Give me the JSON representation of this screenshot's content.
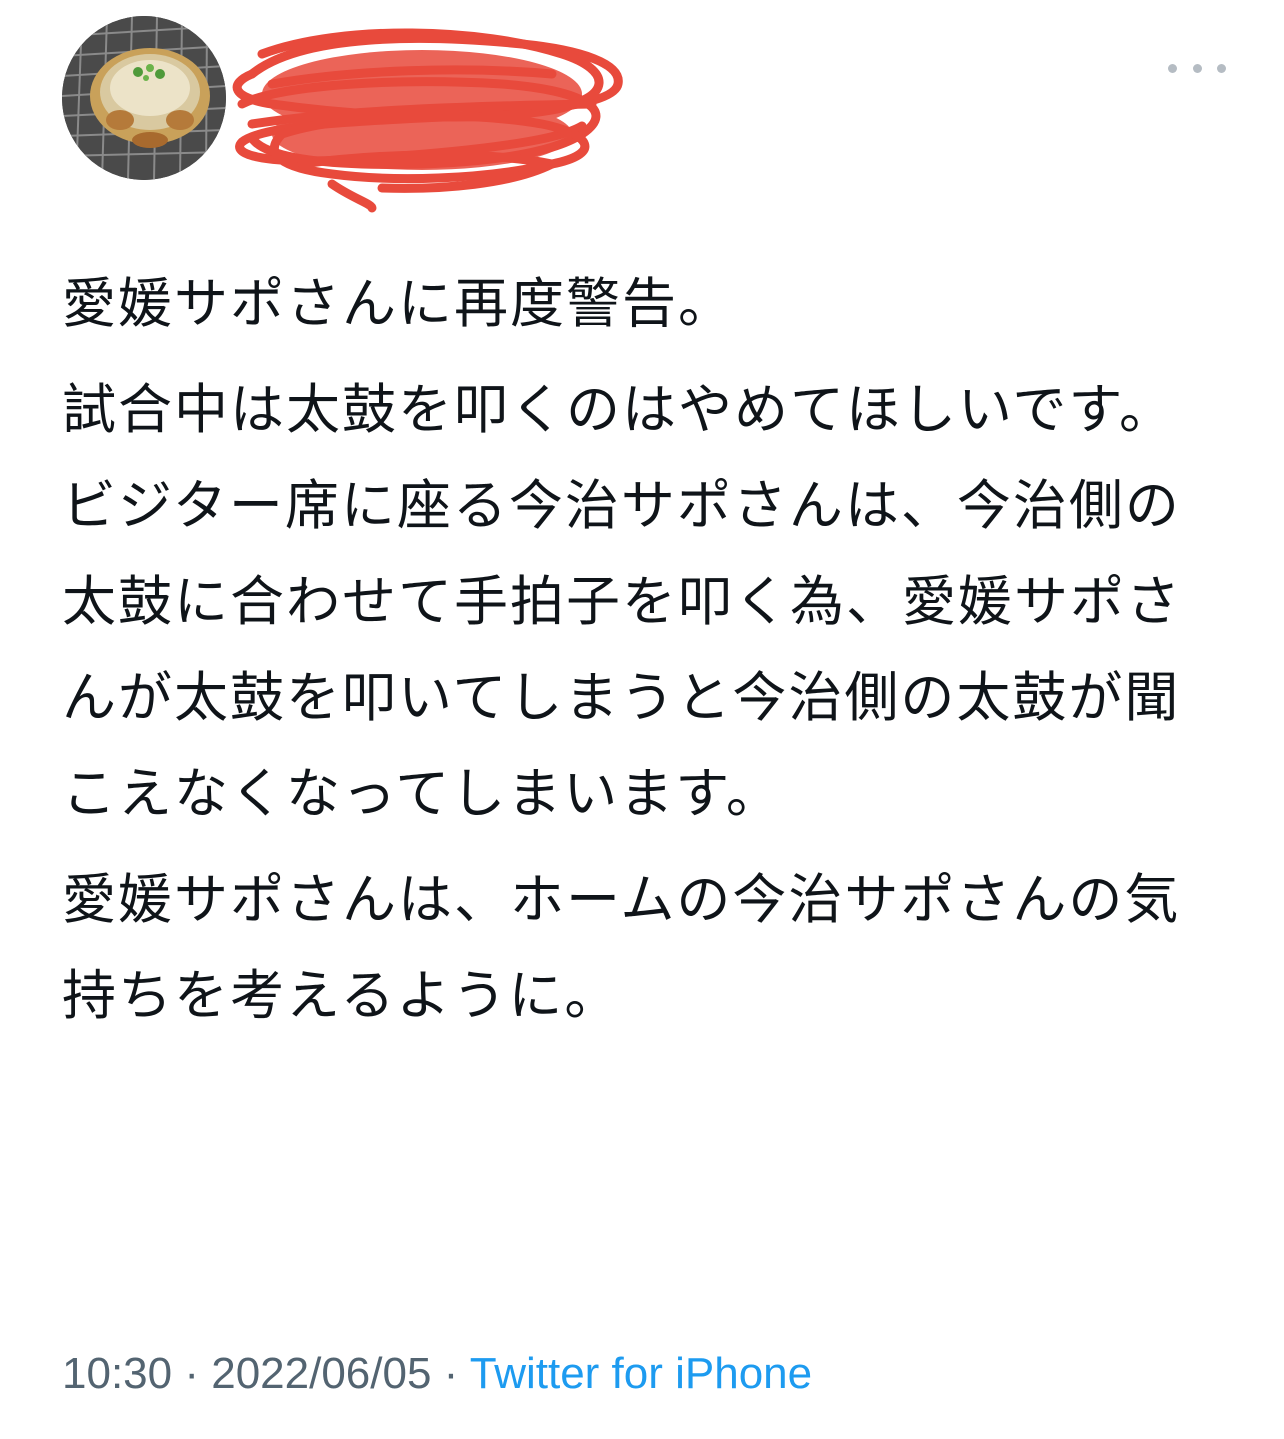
{
  "tweet": {
    "body": {
      "paragraph_1": "愛媛サポさんに再度警告。",
      "paragraph_2": "試合中は太鼓を叩くのはやめてほしいです。\nビジター席に座る今治サポさんは、今治側の太鼓に合わせて手拍子を叩く為、愛媛サポさんが太鼓を叩いてしまうと今治側の太鼓が聞こえなくなってしまいます。",
      "paragraph_3": "愛媛サポさんは、ホームの今治サポさんの気持ちを考えるように。"
    },
    "meta": {
      "time": "10:30",
      "separator_1": " · ",
      "date": "2022/06/05",
      "separator_2": " · ",
      "source": "Twitter for iPhone"
    },
    "icons": {
      "more": "more-horizontal-icon"
    },
    "colors": {
      "text": "#0f1419",
      "meta": "#536471",
      "link": "#1d9bf0",
      "redaction": "#e84a3c"
    }
  }
}
